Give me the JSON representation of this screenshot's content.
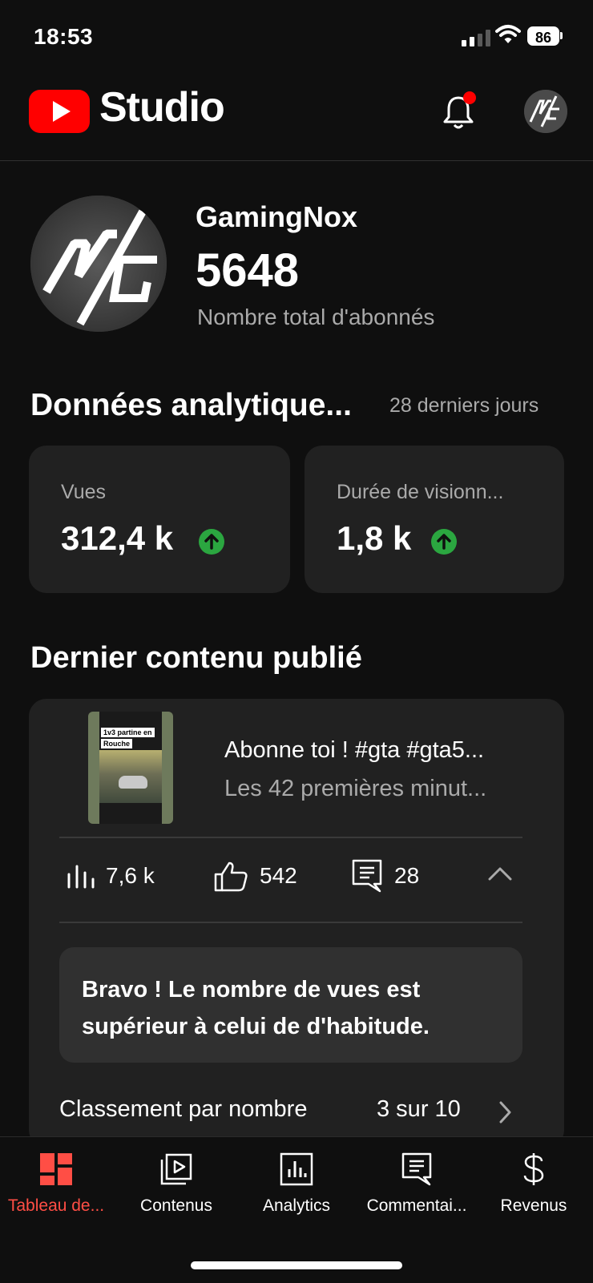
{
  "status_bar": {
    "time": "18:53",
    "battery": "86"
  },
  "header": {
    "logo_text": "Studio",
    "icons": [
      "notifications-bell-icon",
      "account-avatar-icon"
    ]
  },
  "channel": {
    "name": "GamingNox",
    "subscribers": "5648",
    "subscribers_label": "Nombre total d'abonnés"
  },
  "analytics": {
    "title": "Données analytique...",
    "period": "28 derniers jours",
    "metrics": [
      {
        "label": "Vues",
        "value": "312,4 k"
      },
      {
        "label": "Durée de visionn...",
        "value": "1,8 k"
      }
    ]
  },
  "latest": {
    "title": "Dernier contenu publié",
    "thumb_caption_1": "1v3 partine en",
    "thumb_caption_2": "Rouche",
    "video_title": "Abonne toi ! #gta #gta5...",
    "video_desc": "Les 42 premières minut...",
    "views": "7,6 k",
    "likes": "542",
    "comments": "28",
    "tip": "Bravo ! Le nombre de vues est supérieur à celui de d'habitude.",
    "rank_label": "Classement par nombre",
    "rank_value": "3 sur 10"
  },
  "nav": [
    {
      "label": "Tableau de...",
      "icon": "dashboard-icon",
      "active": true
    },
    {
      "label": "Contenus",
      "icon": "content-icon"
    },
    {
      "label": "Analytics",
      "icon": "analytics-icon"
    },
    {
      "label": "Commentai...",
      "icon": "comments-icon"
    },
    {
      "label": "Revenus",
      "icon": "dollar-icon"
    }
  ],
  "colors": {
    "background": "#0f0f0f",
    "card": "#212121",
    "accent": "#ff0000",
    "active_nav": "#ff4e45",
    "up": "#2ba640"
  }
}
